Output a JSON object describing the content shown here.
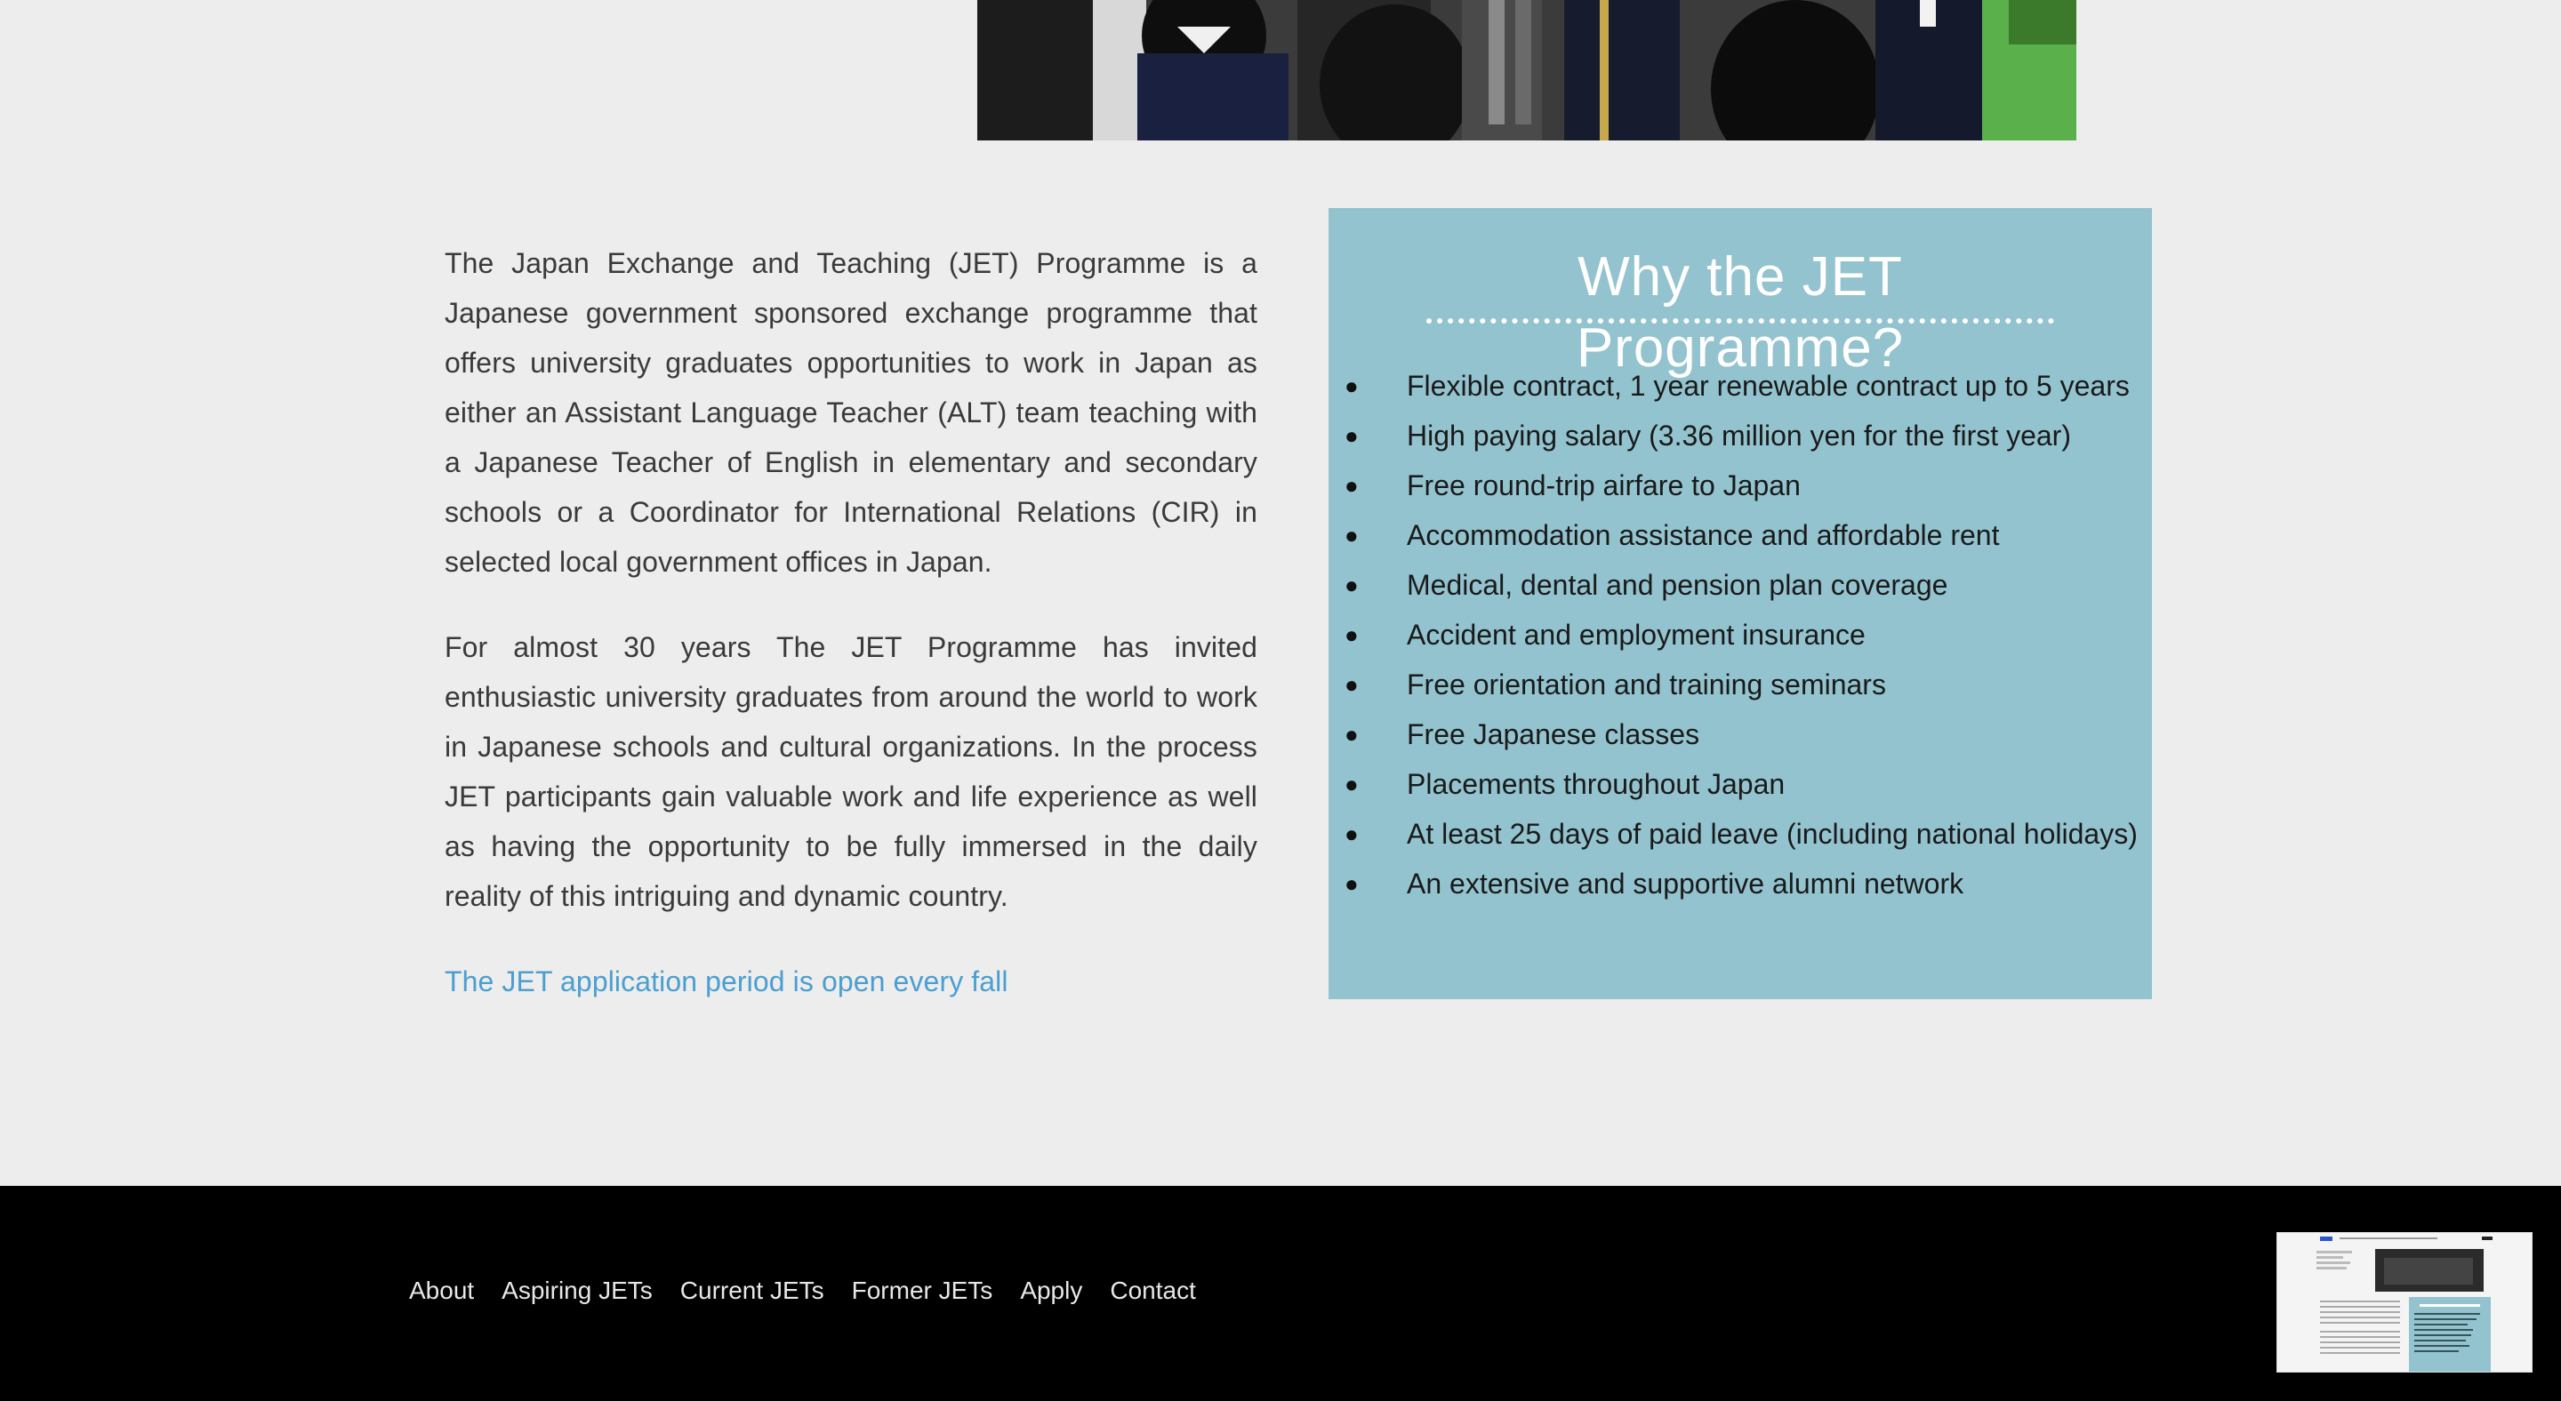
{
  "intro": {
    "paragraphs": [
      "The Japan Exchange and Teaching (JET) Programme is a Japanese government sponsored exchange programme that offers university graduates opportunities to work in Japan as either an Assistant Language Teacher (ALT) team teaching with a Japanese Teacher of English in elementary and secondary schools or a Coordinator for International Relations (CIR) in selected local government offices in Japan.",
      "For almost 30 years The JET Programme has invited enthusiastic university graduates from around the world to work in Japanese schools and cultural organizations. In the process JET participants gain valuable work and life experience as well as having the opportunity to be fully immersed in the daily reality of this intriguing and dynamic country."
    ],
    "apply_link": "The JET application period is open every fall"
  },
  "why": {
    "title": "Why the JET Programme?",
    "bullet_symbol": "●",
    "items": [
      "Flexible contract, 1 year renewable contract up to 5 years",
      "High paying salary (3.36 million yen for the first year)",
      "Free round-trip airfare to Japan",
      "Accommodation assistance and affordable rent",
      "Medical, dental and pension plan coverage",
      "Accident and employment insurance",
      "Free orientation and training seminars",
      "Free Japanese classes",
      "Placements throughout Japan",
      "At least 25 days of paid leave (including national holidays)",
      "An extensive and supportive alumni network"
    ]
  },
  "footer": {
    "nav": [
      "About",
      "Aspiring JETs",
      "Current JETs",
      "Former JETs",
      "Apply",
      "Contact"
    ]
  },
  "colors": {
    "page_bg": "#ededed",
    "why_box_bg": "#93c3cf",
    "link": "#4a9fd0",
    "footer_bg": "#000000"
  }
}
